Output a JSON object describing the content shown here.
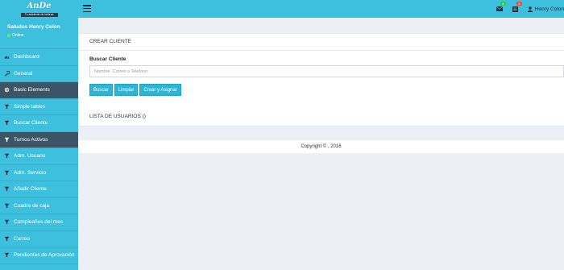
{
  "brand": {
    "logo_text": "AnDe",
    "logo_tagline": "Tu asistente de belleza"
  },
  "user_panel": {
    "greeting": "Saludos Henry Colon",
    "status": "Online"
  },
  "menu": {
    "items": [
      {
        "label": "Dashboard",
        "icon": "dashboard-icon",
        "active": false
      },
      {
        "label": "General",
        "icon": "wrench-icon",
        "active": false
      },
      {
        "label": "Basic Elements",
        "icon": "globe-icon",
        "active": true
      },
      {
        "label": "Simple tables",
        "icon": "filter-icon",
        "active": false
      },
      {
        "label": "Buscar Cliente",
        "icon": "filter-icon",
        "active": false
      },
      {
        "label": "Turnos Activos",
        "icon": "filter-icon",
        "active": true
      },
      {
        "label": "Adm. Usuario",
        "icon": "filter-icon",
        "active": false
      },
      {
        "label": "Adm. Servicio",
        "icon": "filter-icon",
        "active": false
      },
      {
        "label": "Añadir Cliente",
        "icon": "filter-icon",
        "active": false
      },
      {
        "label": "Cuadre de caja",
        "icon": "filter-icon",
        "active": false
      },
      {
        "label": "Cumpleaños del mes",
        "icon": "filter-icon",
        "active": false
      },
      {
        "label": "Correo",
        "icon": "filter-icon",
        "active": false
      },
      {
        "label": "Pendientes de Aprovación",
        "icon": "filter-icon",
        "active": false
      }
    ]
  },
  "topbar": {
    "mail_count": "4",
    "notif_count": "9",
    "user_name": "Henry Colon",
    "colors": {
      "mail_badge": "#2ecc40",
      "notif_badge": "#e74c3c"
    }
  },
  "crear_cliente": {
    "title": "CREAR CLIENTE",
    "search_label": "Buscar Cliente",
    "search_placeholder": "Nombre, Correo o Telefono",
    "buttons": {
      "search": "Buscar",
      "clear": "Limpiar",
      "create": "Crear y Asignar"
    }
  },
  "user_list": {
    "title": "LISTA DE USUARIOS ()"
  },
  "footer": {
    "copyright": "Copyright © , 2016"
  },
  "colors": {
    "sidebar_bg": "#3dc0dd",
    "active_item_bg": "#3c5566",
    "button_bg": "#2db5d8",
    "page_bg": "#ecf0f5"
  }
}
